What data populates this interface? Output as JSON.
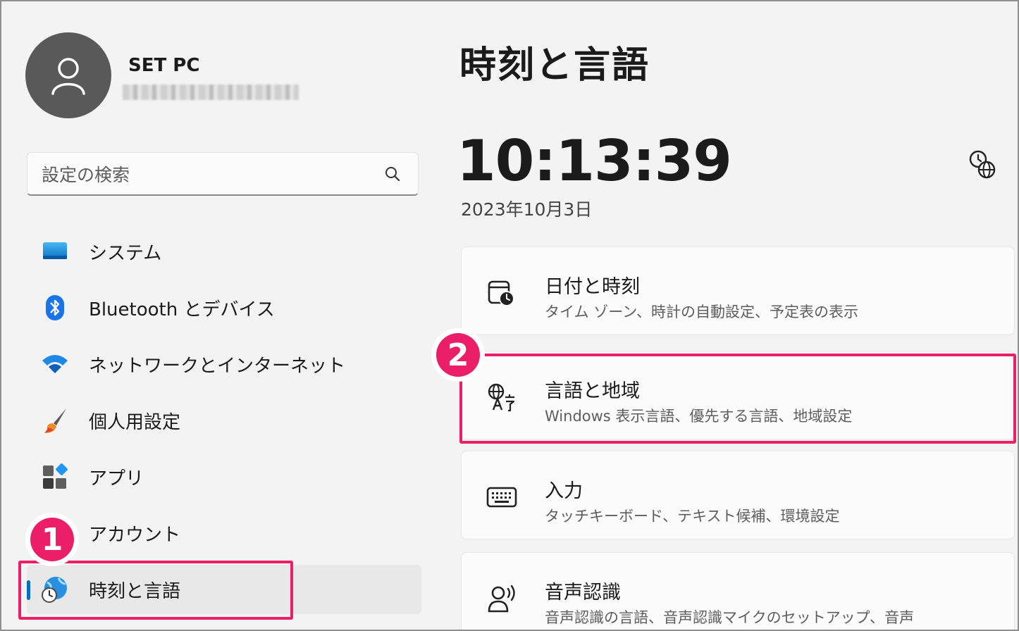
{
  "user": {
    "name": "SET PC"
  },
  "search": {
    "placeholder": "設定の検索"
  },
  "sidebar": {
    "items": [
      {
        "label": "システム",
        "icon": "system-icon"
      },
      {
        "label": "Bluetooth とデバイス",
        "icon": "bluetooth-icon"
      },
      {
        "label": "ネットワークとインターネット",
        "icon": "wifi-icon"
      },
      {
        "label": "個人用設定",
        "icon": "brush-icon"
      },
      {
        "label": "アプリ",
        "icon": "apps-icon"
      },
      {
        "label": "アカウント",
        "icon": "account-icon"
      },
      {
        "label": "時刻と言語",
        "icon": "time-language-icon",
        "selected": true
      }
    ]
  },
  "main": {
    "title": "時刻と言語",
    "clock": "10:13:39",
    "date": "2023年10月3日",
    "cards": [
      {
        "title": "日付と時刻",
        "subtitle": "タイム ゾーン、時計の自動設定、予定表の表示",
        "icon": "calendar-clock-icon"
      },
      {
        "title": "言語と地域",
        "subtitle": "Windows 表示言語、優先する言語、地域設定",
        "icon": "language-icon"
      },
      {
        "title": "入力",
        "subtitle": "タッチキーボード、テキスト候補、環境設定",
        "icon": "keyboard-icon"
      },
      {
        "title": "音声認識",
        "subtitle": "音声認識の言語、音声認識マイクのセットアップ、音声",
        "icon": "speech-icon"
      }
    ]
  },
  "annotations": {
    "step1": "1",
    "step2": "2",
    "accent_color": "#ea1f68"
  },
  "colors": {
    "selection_indicator": "#0f6cbd",
    "background": "#f3f3f3"
  }
}
